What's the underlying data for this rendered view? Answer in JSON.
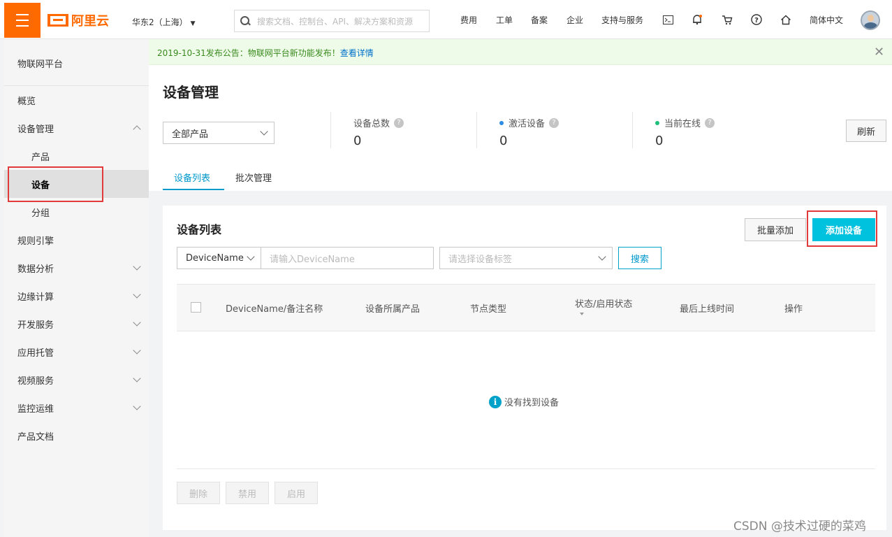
{
  "topbar": {
    "logo_text": "阿里云",
    "region": "华东2（上海）",
    "search_placeholder": "搜索文档、控制台、API、解决方案和资源",
    "nav": [
      "费用",
      "工单",
      "备案",
      "企业",
      "支持与服务"
    ],
    "language": "简体中文",
    "icons": [
      "terminal-icon",
      "bell-icon",
      "cart-icon",
      "help-icon",
      "home-icon"
    ]
  },
  "sidebar": {
    "title": "物联网平台",
    "items": [
      {
        "label": "概览"
      },
      {
        "label": "设备管理"
      },
      {
        "label": "产品"
      },
      {
        "label": "设备"
      },
      {
        "label": "分组"
      },
      {
        "label": "规则引擎"
      },
      {
        "label": "数据分析"
      },
      {
        "label": "边缘计算"
      },
      {
        "label": "开发服务"
      },
      {
        "label": "应用托管"
      },
      {
        "label": "视频服务"
      },
      {
        "label": "监控运维"
      },
      {
        "label": "产品文档"
      }
    ]
  },
  "notice": {
    "text": "2019-10-31发布公告：物联网平台新功能发布！",
    "link": "查看详情"
  },
  "page": {
    "title": "设备管理",
    "product_select": "全部产品",
    "refresh": "刷新",
    "stats": [
      {
        "label": "设备总数",
        "value": "0",
        "dot_color": ""
      },
      {
        "label": "激活设备",
        "value": "0",
        "dot_color": "#2b8ce6"
      },
      {
        "label": "当前在线",
        "value": "0",
        "dot_color": "#1ebf7b"
      }
    ],
    "tabs": [
      "设备列表",
      "批次管理"
    ]
  },
  "panel": {
    "title": "设备列表",
    "bulk_add": "批量添加",
    "add_device": "添加设备",
    "filter_field": "DeviceName",
    "filter_placeholder": "请输入DeviceName",
    "tag_placeholder": "请选择设备标签",
    "search": "搜索",
    "columns": [
      "DeviceName/备注名称",
      "设备所属产品",
      "节点类型",
      "状态/启用状态",
      "最后上线时间",
      "操作"
    ],
    "empty": "没有找到设备",
    "footer_buttons": [
      "删除",
      "禁用",
      "启用"
    ]
  },
  "watermark": "CSDN @技术过硬的菜鸡",
  "colors": {
    "brand": "#ff6a00",
    "primary": "#00c1de",
    "highlight": "#e03a3a"
  }
}
